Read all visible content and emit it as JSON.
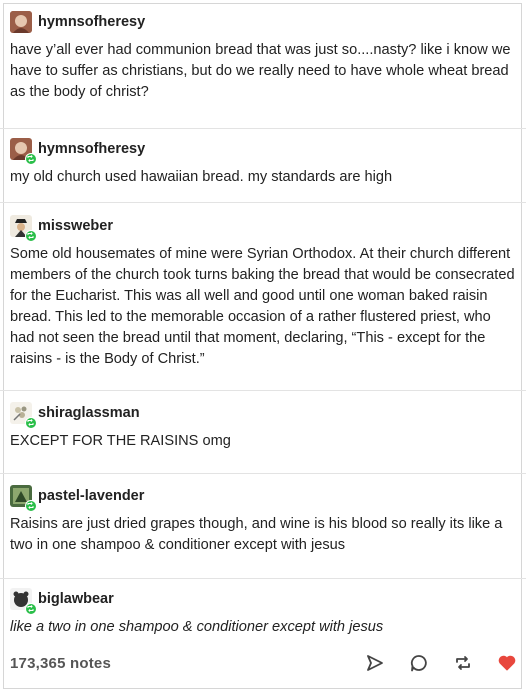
{
  "posts": [
    {
      "username": "hymnsofheresy",
      "body": "have y’all ever had communion bread that was just so....nasty? like i know we have to suffer as christians, but do we really need to have whole wheat bread as the body of christ?",
      "italic": false,
      "reblog": false
    },
    {
      "username": "hymnsofheresy",
      "body": "my old church used hawaiian bread. my standards are high",
      "italic": false,
      "reblog": true
    },
    {
      "username": "missweber",
      "body": "Some old housemates of mine were Syrian Orthodox. At their church different members of the church took turns baking the bread that would be consecrated for the Eucharist. This was all well and good until one woman baked raisin bread. This led to the memorable occasion of a rather flustered priest, who had not seen the bread until that moment, declaring, “This - except for the raisins - is the Body of Christ.”",
      "italic": false,
      "reblog": true
    },
    {
      "username": "shiraglassman",
      "body": "EXCEPT FOR THE RAISINS omg",
      "italic": false,
      "reblog": true
    },
    {
      "username": "pastel-lavender",
      "body": "Raisins are just dried grapes though, and wine is his blood so really its like a two in one shampoo & conditioner except with jesus",
      "italic": false,
      "reblog": true
    },
    {
      "username": "biglawbear",
      "body": "like a two in one shampoo & conditioner except with jesus",
      "italic": true,
      "reblog": true
    }
  ],
  "footer": {
    "notes": "173,365 notes",
    "icons": [
      "share-icon",
      "reply-icon",
      "reblog-icon",
      "like-icon"
    ],
    "like_color": "#e8473d"
  },
  "colors": {
    "reblog_badge": "#2bbf4a"
  }
}
